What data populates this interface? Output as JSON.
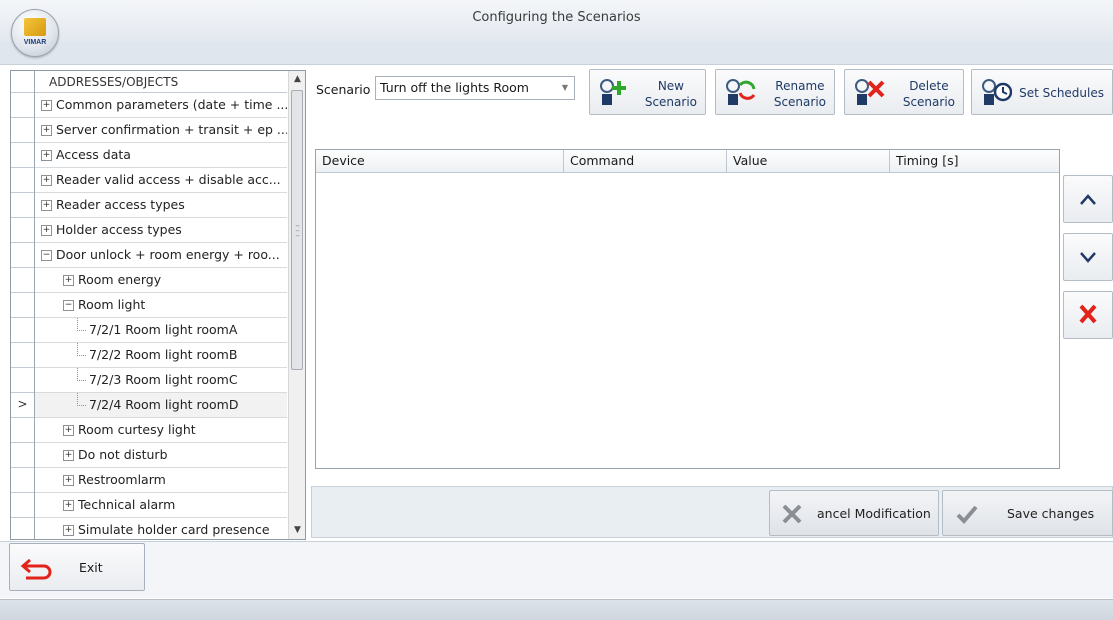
{
  "window": {
    "title": "Configuring the Scenarios",
    "logo_text": "VIMAR"
  },
  "tree": {
    "header": "ADDRESSES/OBJECTS",
    "items": [
      {
        "label": "Common parameters (date + time ...",
        "level": 0,
        "expander": "+"
      },
      {
        "label": "Server confirmation + transit + ep ...",
        "level": 0,
        "expander": "+"
      },
      {
        "label": "Access data",
        "level": 0,
        "expander": "+"
      },
      {
        "label": "Reader valid access + disable acc...",
        "level": 0,
        "expander": "+"
      },
      {
        "label": "Reader access types",
        "level": 0,
        "expander": "+"
      },
      {
        "label": "Holder access types",
        "level": 0,
        "expander": "+"
      },
      {
        "label": "Door unlock + room energy + roo...",
        "level": 0,
        "expander": "−"
      },
      {
        "label": "Room energy",
        "level": 1,
        "expander": "+"
      },
      {
        "label": "Room light",
        "level": 1,
        "expander": "−"
      },
      {
        "label": "7/2/1 Room light roomA",
        "level": 2,
        "expander": ""
      },
      {
        "label": "7/2/2 Room light roomB",
        "level": 2,
        "expander": ""
      },
      {
        "label": "7/2/3 Room light roomC",
        "level": 2,
        "expander": ""
      },
      {
        "label": "7/2/4 Room light roomD",
        "level": 2,
        "expander": "",
        "selected": true
      },
      {
        "label": "Room curtesy light",
        "level": 1,
        "expander": "+"
      },
      {
        "label": "Do not disturb",
        "level": 1,
        "expander": "+"
      },
      {
        "label": "Restroomlarm",
        "level": 1,
        "expander": "+"
      },
      {
        "label": "Technical alarm",
        "level": 1,
        "expander": "+"
      },
      {
        "label": "Simulate holder card presence",
        "level": 1,
        "expander": "+"
      }
    ],
    "row_indicator": ">"
  },
  "scenario": {
    "label": "Scenario",
    "selected": "Turn off the lights Room"
  },
  "toolbar": {
    "new_label_1": "New",
    "new_label_2": "Scenario",
    "rename_label_1": "Rename",
    "rename_label_2": "Scenario",
    "delete_label_1": "Delete",
    "delete_label_2": "Scenario",
    "schedules_label": "Set Schedules"
  },
  "grid": {
    "columns": [
      "Device",
      "Command",
      "Value",
      "Timing [s]"
    ]
  },
  "actions": {
    "cancel_label": "ancel Modification",
    "save_label": "Save changes"
  },
  "exit": {
    "label": "Exit"
  },
  "colors": {
    "red": "#e2231a",
    "green": "#2fa62c",
    "navy": "#1f3a66"
  }
}
